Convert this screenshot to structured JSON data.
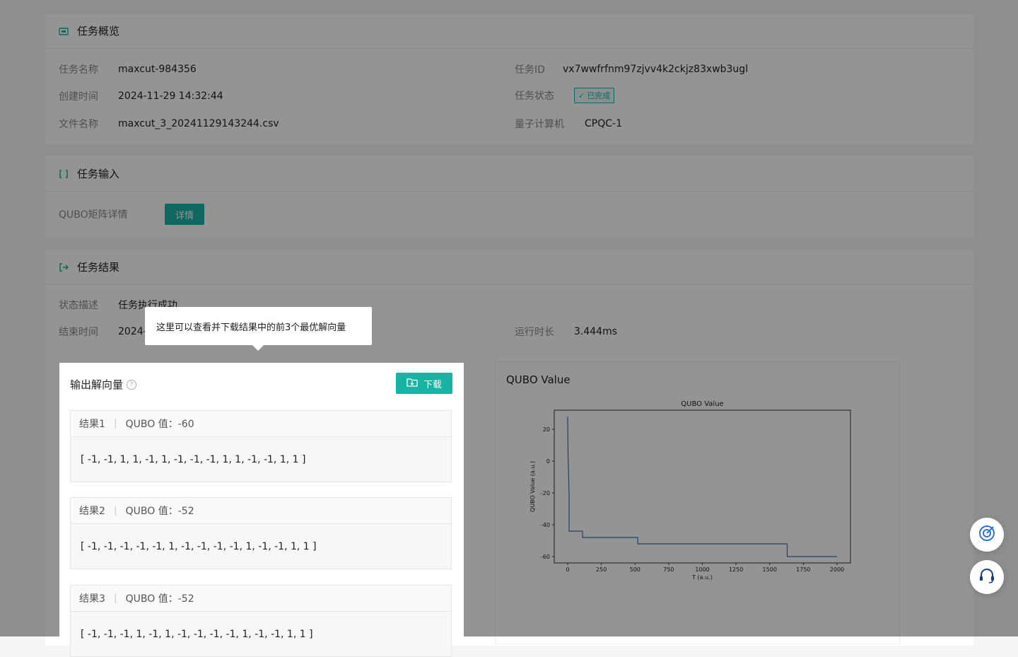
{
  "overview": {
    "title": "任务概览",
    "task_name_label": "任务名称",
    "task_name": "maxcut-984356",
    "task_id_label": "任务ID",
    "task_id": "vx7wwfrfnm97zjvv4k2ckjz83xwb3ugl",
    "created_label": "创建时间",
    "created": "2024-11-29 14:32:44",
    "status_label": "任务状态",
    "status": "已完成",
    "file_label": "文件名称",
    "file": "maxcut_3_20241129143244.csv",
    "computer_label": "量子计算机",
    "computer": "CPQC-1"
  },
  "input": {
    "title": "任务输入",
    "qubo_label": "QUBO矩阵详情",
    "detail_button": "详情"
  },
  "result": {
    "title": "任务结果",
    "state_desc_label": "状态描述",
    "state_desc": "任务执行成功",
    "end_time_label": "结束时间",
    "end_time": "2024-",
    "runtime_label": "运行时长",
    "runtime": "3.444ms"
  },
  "solutions": {
    "title": "输出解向量",
    "download_button": "下载",
    "items": [
      {
        "label": "结果1",
        "qubo": "QUBO 值：-60",
        "vector": "[ -1, -1, 1, 1, -1, 1, -1, -1, -1, 1, 1, -1, -1, 1, 1 ]"
      },
      {
        "label": "结果2",
        "qubo": "QUBO 值：-52",
        "vector": "[ -1, -1, -1, -1, -1, 1, -1, -1, -1, -1, 1, -1, -1, 1, 1 ]"
      },
      {
        "label": "结果3",
        "qubo": "QUBO 值：-52",
        "vector": "[ -1, -1, -1, 1, -1, 1, -1, -1, -1, -1, 1, -1, -1, 1, 1 ]"
      }
    ]
  },
  "tooltip": "这里可以查看并下载结果中的前3个最优解向量",
  "chart_panel_title": "QUBO Value",
  "icons": {
    "float_1": "target-icon",
    "float_2": "headset-icon"
  },
  "accent_color": "#19b3a5",
  "chart_data": {
    "type": "line",
    "title": "QUBO Value",
    "xlabel": "T (a.u.)",
    "ylabel": "QUBO Value (a.u.)",
    "xlim": [
      -100,
      2100
    ],
    "ylim": [
      -64,
      32
    ],
    "xticks": [
      0,
      250,
      500,
      750,
      1000,
      1250,
      1500,
      1750,
      2000
    ],
    "yticks": [
      20,
      0,
      -20,
      -40,
      -60
    ],
    "series": [
      {
        "x": [
          0,
          3,
          10,
          10,
          110,
          110,
          520,
          520,
          1630,
          1630,
          2000
        ],
        "y": [
          28,
          2,
          -20,
          -44,
          -44,
          -48,
          -48,
          -52,
          -52,
          -60,
          -60
        ]
      }
    ],
    "color": "#3a72b0"
  }
}
